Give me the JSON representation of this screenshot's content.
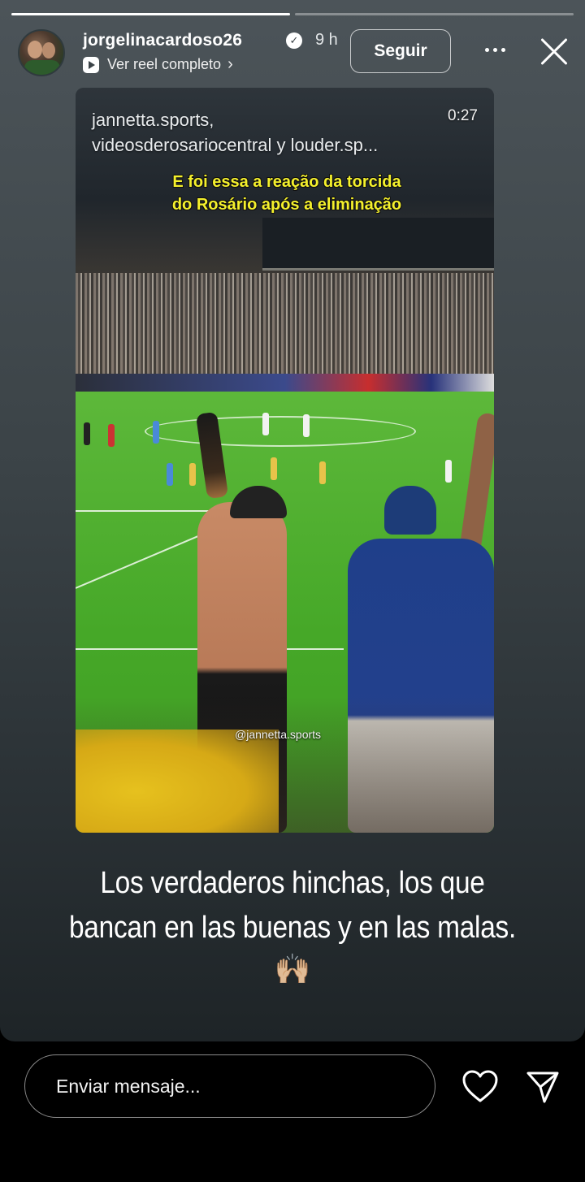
{
  "progress": {
    "segments": 2,
    "current": 1
  },
  "header": {
    "username": "jorgelinacardoso26",
    "verified": true,
    "time_ago": "9 h",
    "reel_link_label": "Ver reel completo",
    "follow_label": "Seguir"
  },
  "video": {
    "handles_line1": "jannetta.sports,",
    "handles_line2": "videosderosariocentral y louder.sp...",
    "duration": "0:27",
    "caption_line1": "E foi essa a reação da torcida",
    "caption_line2": "do Rosário após a eliminação",
    "watermark": "@jannetta.sports"
  },
  "story": {
    "caption_line1": "Los verdaderos hinchas, los que",
    "caption_line2": "bancan en las buenas y en las malas.",
    "emoji": "🙌🏼"
  },
  "footer": {
    "message_placeholder": "Enviar mensaje..."
  },
  "colors": {
    "caption_yellow": "#f4f02c",
    "field_green": "#4cac2a",
    "story_bg": "#3b4347"
  },
  "icons": {
    "like": "heart-icon",
    "share": "send-icon",
    "more": "more-icon",
    "close": "close-icon",
    "reel": "reel-icon"
  }
}
